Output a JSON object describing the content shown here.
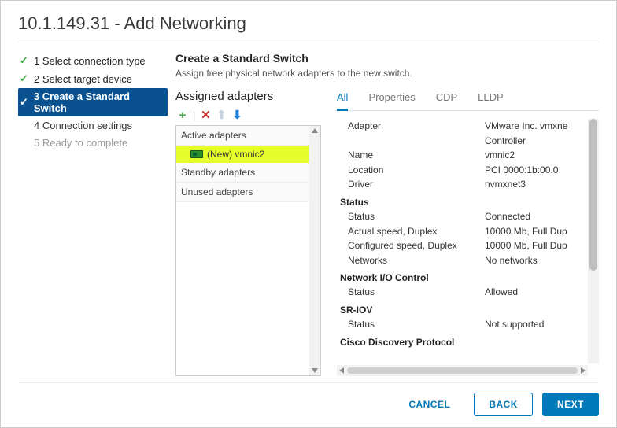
{
  "title": "10.1.149.31 - Add Networking",
  "steps": [
    {
      "label": "1 Select connection type"
    },
    {
      "label": "2 Select target device"
    },
    {
      "label": "3 Create a Standard Switch"
    },
    {
      "label": "4 Connection settings"
    },
    {
      "label": "5 Ready to complete"
    }
  ],
  "panel": {
    "title": "Create a Standard Switch",
    "desc": "Assign free physical network adapters to the new switch."
  },
  "adapters": {
    "title": "Assigned adapters",
    "groups": [
      "Active adapters",
      "Standby adapters",
      "Unused adapters"
    ],
    "items": [
      {
        "label": "(New) vmnic2"
      }
    ]
  },
  "tabs": [
    "All",
    "Properties",
    "CDP",
    "LLDP"
  ],
  "detail": {
    "adapter_k": "Adapter",
    "adapter_v": "VMware Inc. vmxne",
    "adapter_v2": "Controller",
    "name_k": "Name",
    "name_v": "vmnic2",
    "location_k": "Location",
    "location_v": "PCI 0000:1b:00.0",
    "driver_k": "Driver",
    "driver_v": "nvmxnet3",
    "status_sec": "Status",
    "status_k": "  Status",
    "status_v": "Connected",
    "aspeed_k": "  Actual speed, Duplex",
    "aspeed_v": "10000 Mb, Full Dup",
    "cspeed_k": "  Configured speed, Duplex",
    "cspeed_v": "10000 Mb, Full Dup",
    "networks_k": "  Networks",
    "networks_v": "No networks",
    "nioc_sec": "Network I/O Control",
    "nioc_k": "  Status",
    "nioc_v": "Allowed",
    "sriov_sec": "SR-IOV",
    "sriov_k": "  Status",
    "sriov_v": "Not supported",
    "cdp_sec": "Cisco Discovery Protocol"
  },
  "buttons": {
    "cancel": "CANCEL",
    "back": "BACK",
    "next": "NEXT"
  }
}
